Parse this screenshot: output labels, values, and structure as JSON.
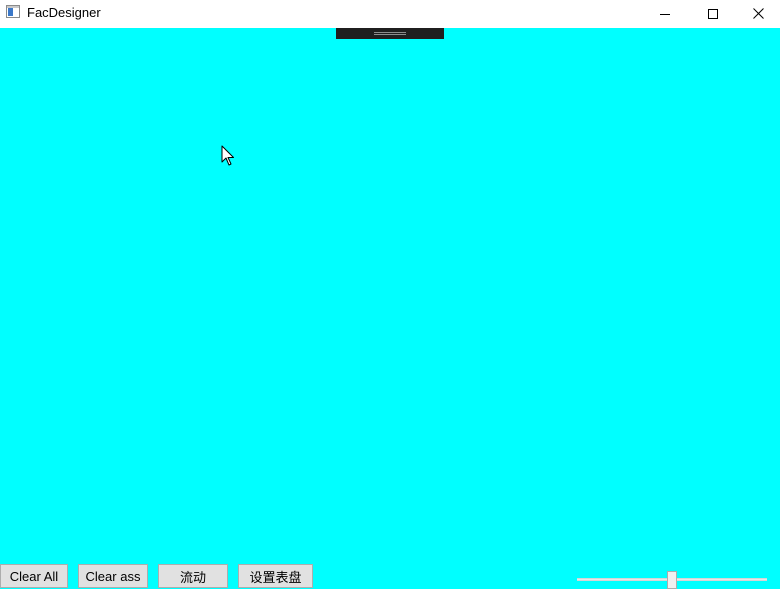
{
  "window": {
    "title": "FacDesigner",
    "icons": {
      "app": "app-window-icon",
      "minimize": "minimize-icon",
      "maximize": "maximize-icon",
      "close": "close-icon"
    }
  },
  "canvas": {
    "background_color": "#00ffff",
    "drag_handle_color": "#1f1f1f"
  },
  "toolbar": {
    "buttons": [
      {
        "label": "Clear All"
      },
      {
        "label": "Clear ass"
      },
      {
        "label": "流动"
      },
      {
        "label": "设置表盘"
      }
    ]
  },
  "slider": {
    "value_fraction": 0.5
  }
}
